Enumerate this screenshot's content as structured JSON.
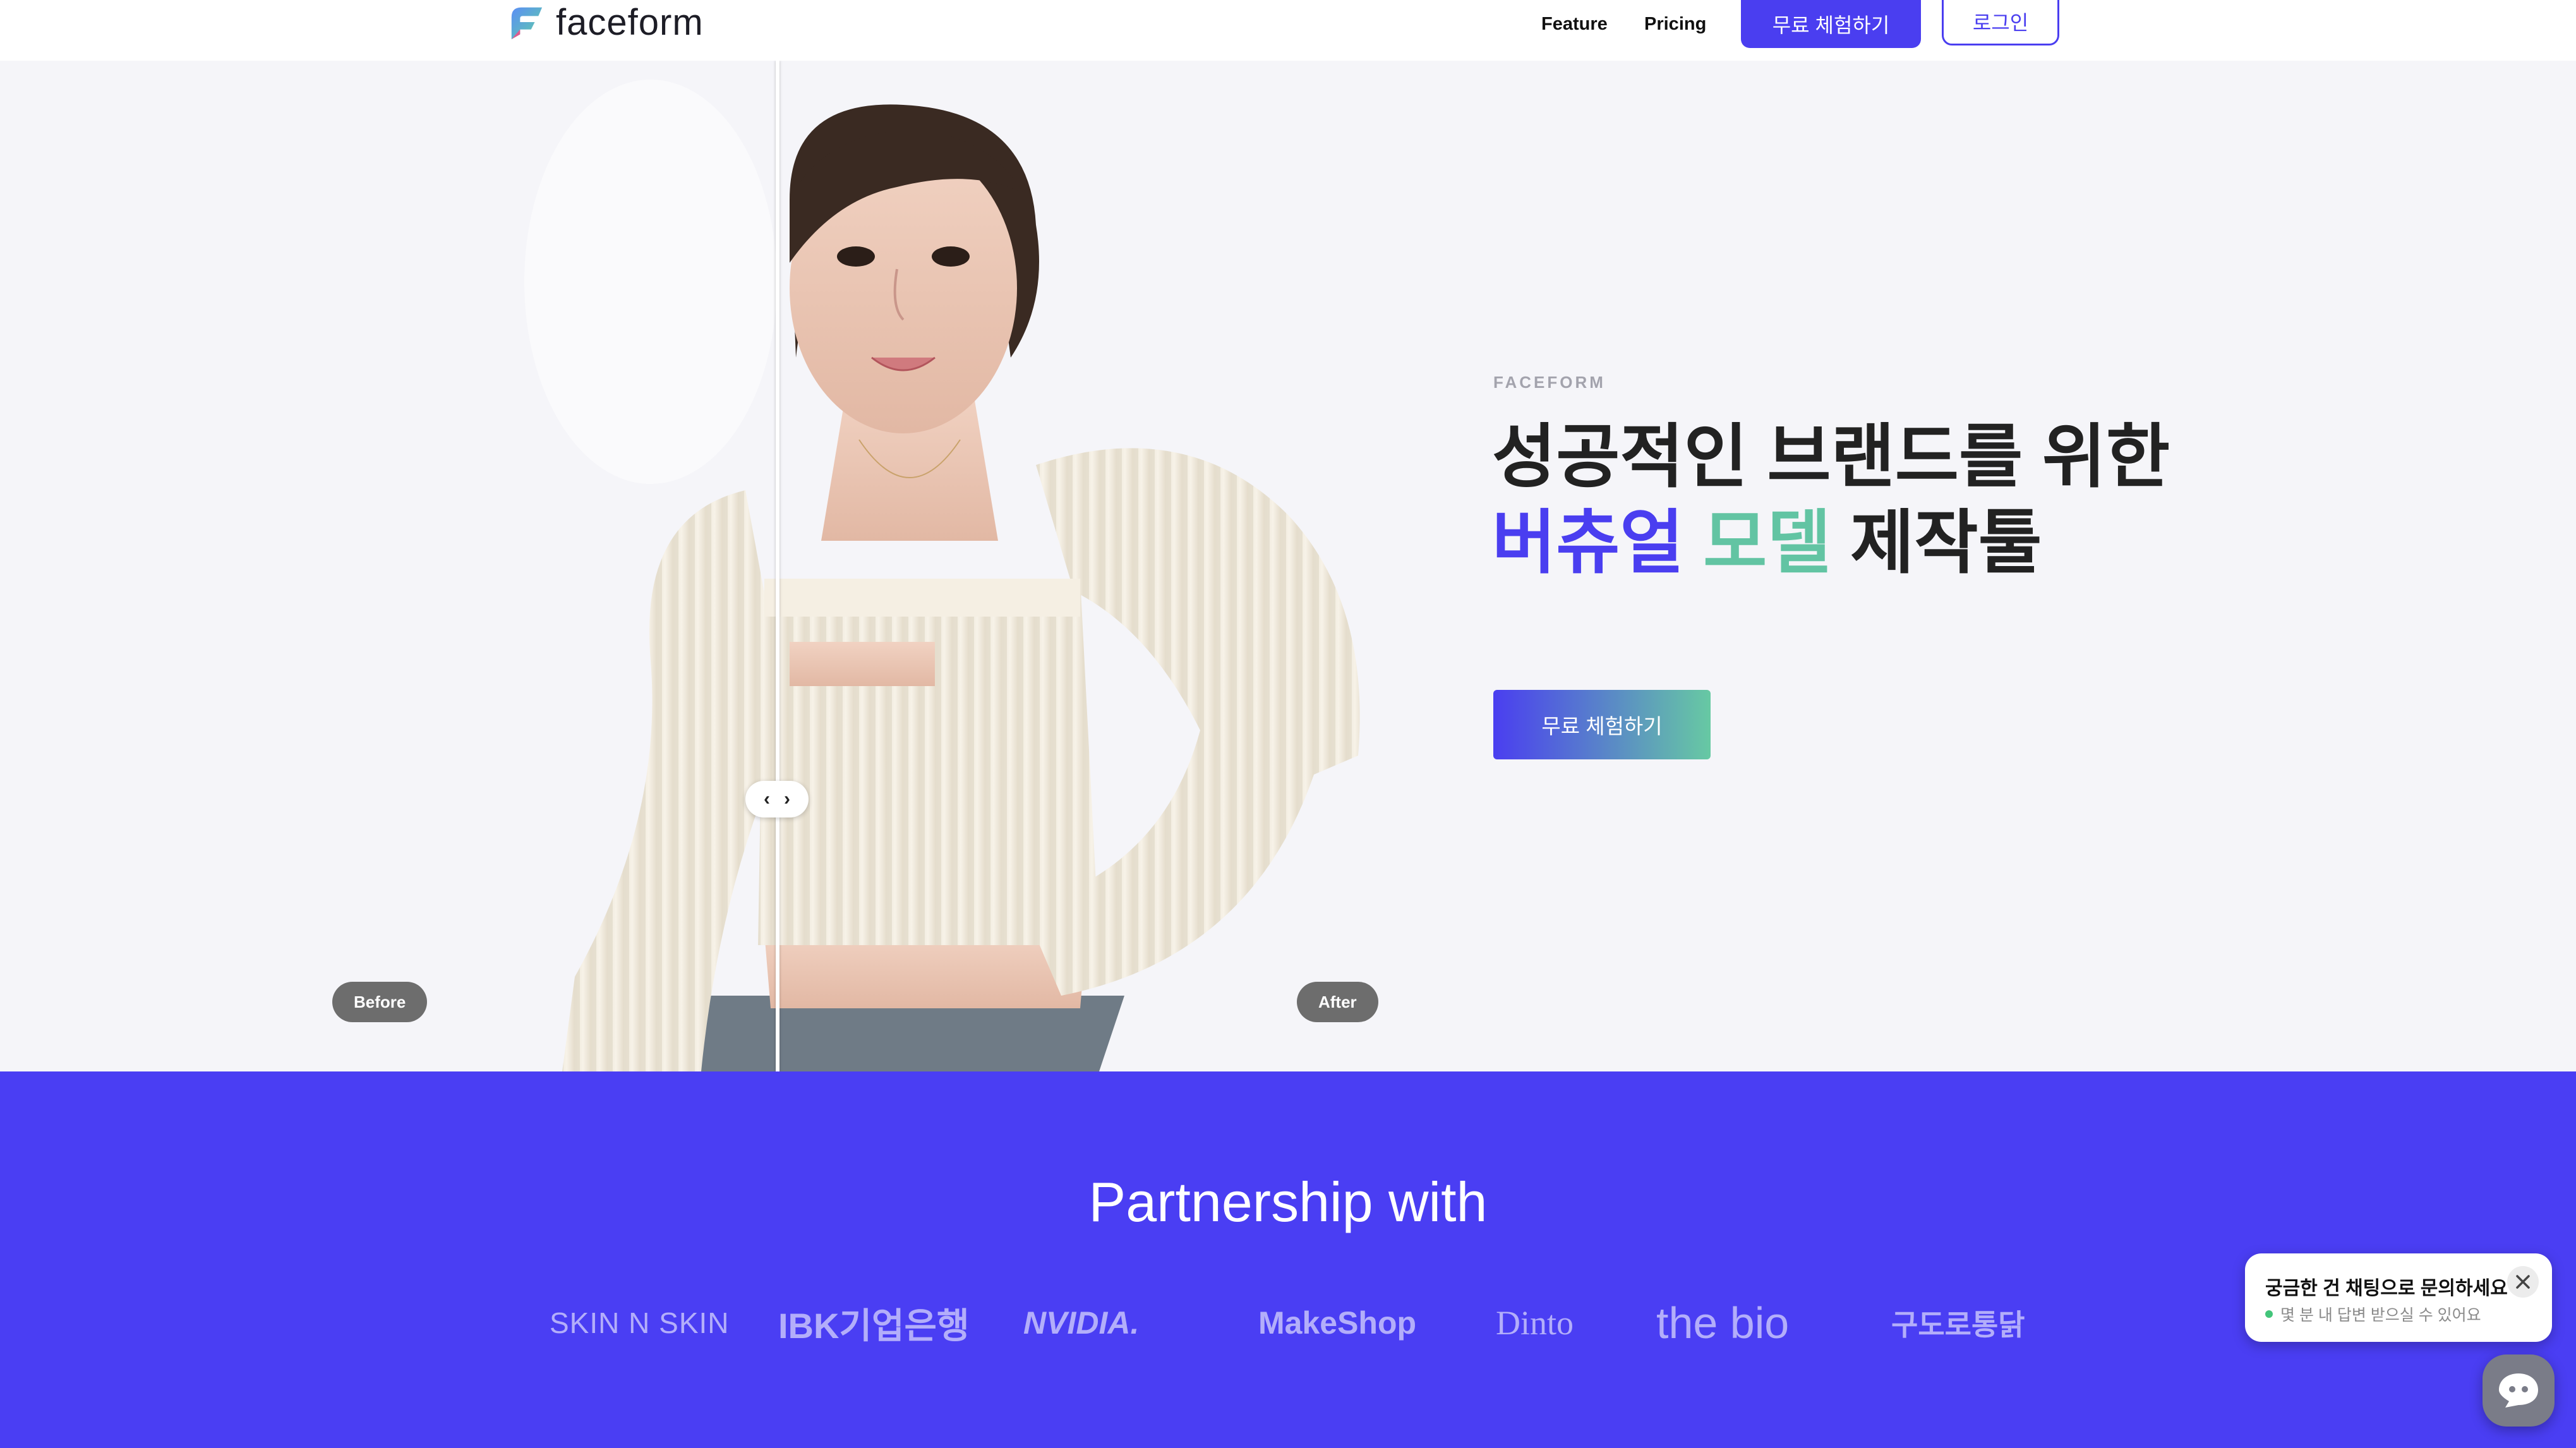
{
  "header": {
    "brand": "faceform",
    "nav": [
      {
        "label": "Feature"
      },
      {
        "label": "Pricing"
      }
    ],
    "cta_label": "무료 체험하기",
    "login_label": "로그인"
  },
  "hero": {
    "eyebrow": "FACEFORM",
    "headline_line1": "성공적인 브랜드를 위한",
    "headline_word_purple": "버츄얼",
    "headline_word_teal": "모델",
    "headline_word_rest": "제작툴",
    "cta_label": "무료 체험하기",
    "before_label": "Before",
    "after_label": "After",
    "colors": {
      "accent": "#4a3ef0",
      "teal": "#62c4a3"
    }
  },
  "partners": {
    "title": "Partnership with",
    "logos": [
      "SKIN N SKIN",
      "IBK기업은행",
      "NVIDIA.",
      "MakeShop",
      "Dinto",
      "the bio",
      "구도로통닭"
    ]
  },
  "chat": {
    "title": "궁금한 건 채팅으로 문의하세요",
    "subtitle": "몇 분 내 답변 받으실 수 있어요"
  }
}
